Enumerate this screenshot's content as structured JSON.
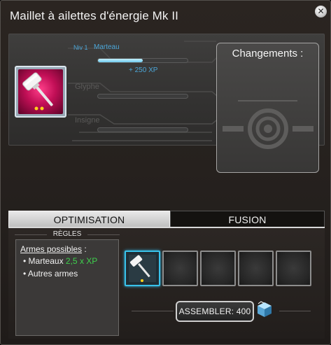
{
  "window": {
    "title": "Maillet à ailettes d'énergie Mk II",
    "close_glyph": "✕"
  },
  "item": {
    "icon": "hammer-icon",
    "level_label": "Niv 1",
    "type_label": "Marteau",
    "xp_gain_label": "+ 250 XP",
    "xp_progress": 0.5,
    "glyph_label": "Glyphe",
    "insignia_label": "Insigne"
  },
  "changes": {
    "title": "Changements :",
    "emblem_icon": "target-emblem-icon"
  },
  "tabs": [
    {
      "label": "OPTIMISATION",
      "active": true
    },
    {
      "label": "FUSION",
      "active": false
    }
  ],
  "rules": {
    "header": "RÈGLES",
    "possible_weapons_label": "Armes possibles",
    "colon": " :",
    "items": [
      {
        "name": "Marteaux",
        "multiplier": "2,5 x XP"
      },
      {
        "name": "Autres armes",
        "multiplier": ""
      }
    ]
  },
  "slots": {
    "count": 5,
    "filled_index": 0,
    "filled_icon": "hammer-icon"
  },
  "assemble": {
    "label": "ASSEMBLER: 400",
    "icon": "cube-material-icon"
  },
  "colors": {
    "accent_blue": "#4ca6d8",
    "xp_green": "#3ed04c",
    "item_rarity_pink": "#c10f56"
  }
}
